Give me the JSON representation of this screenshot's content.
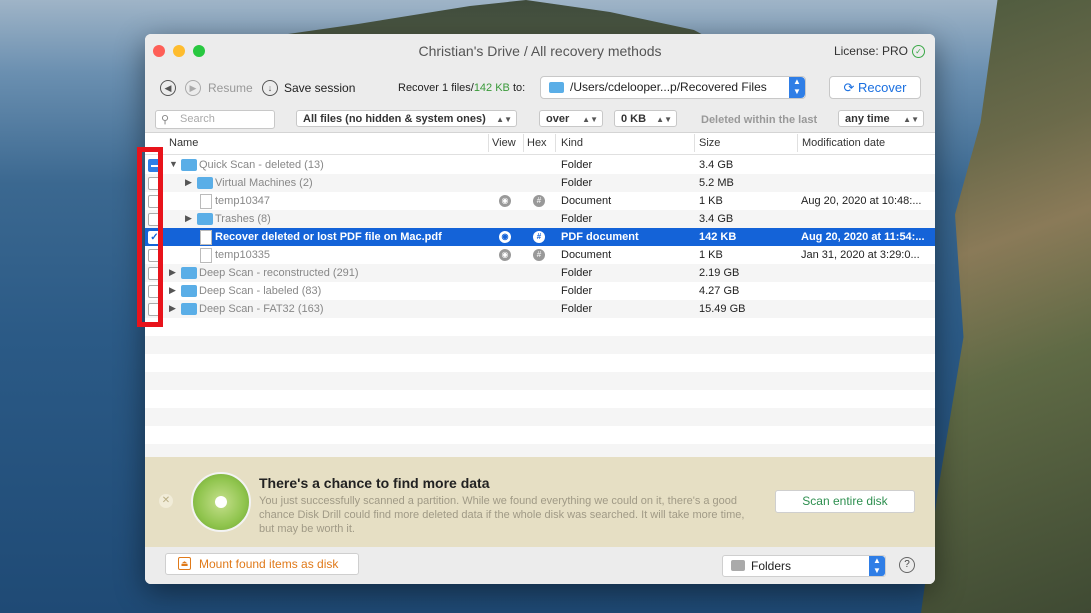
{
  "window": {
    "title": "Christian's Drive / All recovery methods",
    "license": "License: PRO"
  },
  "toolbar": {
    "resume_label": "Resume",
    "save_session_label": "Save session",
    "recover_prefix": "Recover 1 files/",
    "recover_size": "142 KB",
    "recover_to": "to:",
    "path": "/Users/cdelooper...p/Recovered Files",
    "recover_button": "Recover"
  },
  "filters": {
    "search_placeholder": "Search",
    "file_filter": "All files (no hidden & system ones)",
    "size_op": "over",
    "size_value": "0 KB",
    "deleted_label": "Deleted within the last",
    "time_value": "any time"
  },
  "columns": {
    "name": "Name",
    "view": "View",
    "hex": "Hex",
    "kind": "Kind",
    "size": "Size",
    "modified": "Modification date"
  },
  "rows": [
    {
      "name": "Quick Scan - deleted (13)",
      "kind": "Folder",
      "size": "3.4 GB",
      "modified": ""
    },
    {
      "name": "Virtual Machines (2)",
      "kind": "Folder",
      "size": "5.2 MB",
      "modified": ""
    },
    {
      "name": "temp10347",
      "kind": "Document",
      "size": "1 KB",
      "modified": "Aug 20, 2020 at 10:48:..."
    },
    {
      "name": "Trashes (8)",
      "kind": "Folder",
      "size": "3.4 GB",
      "modified": ""
    },
    {
      "name": "Recover deleted or lost PDF file on Mac.pdf",
      "kind": "PDF document",
      "size": "142 KB",
      "modified": "Aug 20, 2020 at 11:54:..."
    },
    {
      "name": "temp10335",
      "kind": "Document",
      "size": "1 KB",
      "modified": "Jan 31, 2020 at 3:29:0..."
    },
    {
      "name": "Deep Scan - reconstructed (291)",
      "kind": "Folder",
      "size": "2.19 GB",
      "modified": ""
    },
    {
      "name": "Deep Scan - labeled (83)",
      "kind": "Folder",
      "size": "4.27 GB",
      "modified": ""
    },
    {
      "name": "Deep Scan - FAT32 (163)",
      "kind": "Folder",
      "size": "15.49 GB",
      "modified": ""
    }
  ],
  "banner": {
    "title": "There's a chance to find more data",
    "description": "You just successfully scanned a partition. While we found everything we could on it, there's a good chance Disk Drill could find more deleted data if the whole disk was searched. It will take more time, but may be worth it.",
    "scan_button": "Scan entire disk"
  },
  "footer": {
    "mount_button": "Mount found items as disk",
    "view_select": "Folders",
    "help": "?"
  },
  "colors": {
    "accent": "#1463d8",
    "highlight": "#e8131b",
    "size_green": "#3a9a3a",
    "mount_orange": "#e07a1a"
  }
}
